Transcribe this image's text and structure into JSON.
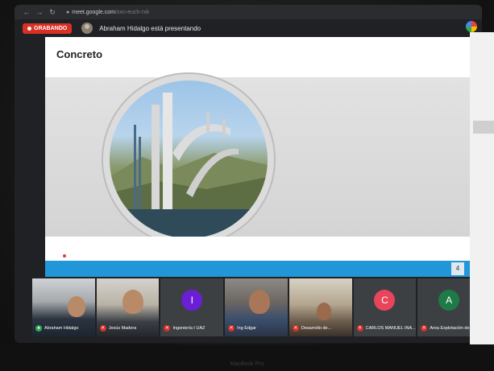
{
  "browser": {
    "url_host": "meet.google.com",
    "url_path": "/xxn-euch-rxk"
  },
  "meeting": {
    "recording_label": "GRABANDO",
    "presenting_text": "Abraham Hidalgo está presentando"
  },
  "slide": {
    "title": "Concreto",
    "page_number": "4"
  },
  "participants": [
    {
      "name": "Abraham Hidalgo",
      "muted": false
    },
    {
      "name": "Jesús Madera",
      "muted": true
    },
    {
      "name": "Ingeniería I UAZ",
      "muted": true,
      "initial": "I",
      "avatar_color": "#6a1fd6"
    },
    {
      "name": "Ing Edgar",
      "muted": true
    },
    {
      "name": "Desarrollo de...",
      "muted": true
    },
    {
      "name": "CARLOS MANUEL INA...",
      "muted": true,
      "initial": "C",
      "avatar_color": "#e8455d"
    },
    {
      "name": "Area Explotación de Tit...",
      "muted": true,
      "initial": "A",
      "avatar_color": "#1e7a46"
    }
  ],
  "device": {
    "label": "MacBook Pro"
  },
  "colors": {
    "recording": "#d93025",
    "slide_footer": "#2196d8"
  }
}
